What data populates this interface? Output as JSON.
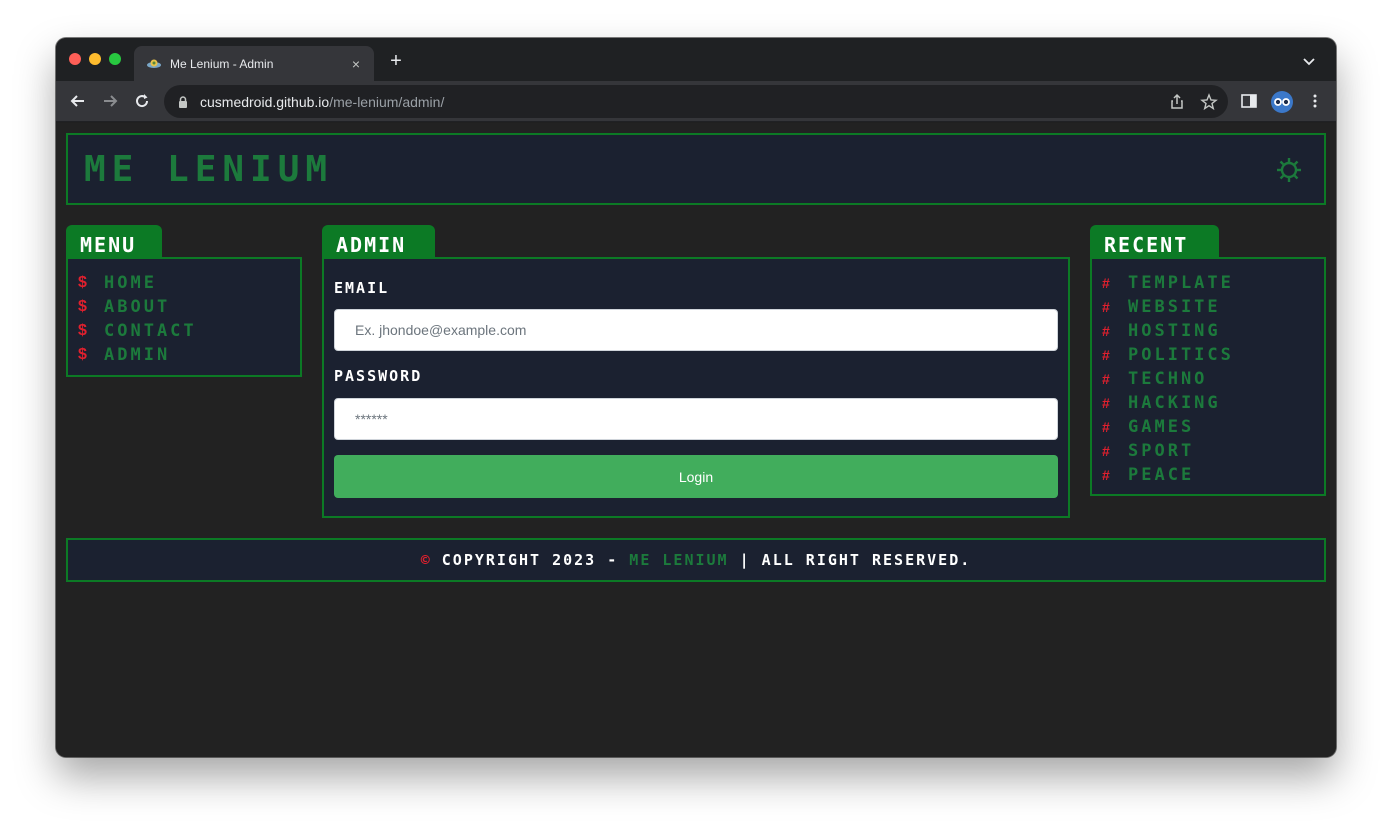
{
  "browser": {
    "tab_title": "Me Lenium - Admin",
    "tab_close": "×",
    "new_tab": "+",
    "url_host": "cusmedroid.github.io",
    "url_path": "/me-lenium/admin/"
  },
  "site": {
    "title": "Me Lenium"
  },
  "menu": {
    "label": "Menu",
    "bullet": "$",
    "items": [
      {
        "label": "Home"
      },
      {
        "label": "About"
      },
      {
        "label": "Contact"
      },
      {
        "label": "Admin"
      }
    ]
  },
  "admin": {
    "label": "Admin",
    "email_label": "Email",
    "email_placeholder": "Ex. jhondoe@example.com",
    "password_label": "Password",
    "password_placeholder": "******",
    "login_label": "Login"
  },
  "recent": {
    "label": "Recent",
    "bullet": "#",
    "items": [
      {
        "label": "Template"
      },
      {
        "label": "Website"
      },
      {
        "label": "Hosting"
      },
      {
        "label": "Politics"
      },
      {
        "label": "Techno"
      },
      {
        "label": "Hacking"
      },
      {
        "label": "Games"
      },
      {
        "label": "Sport"
      },
      {
        "label": "Peace"
      }
    ]
  },
  "footer": {
    "copy_symbol": "©",
    "prefix": "Copyright 2023 - ",
    "brand": "Me Lenium",
    "suffix": " | All Right Reserved."
  },
  "colors": {
    "accent": "#0c7a25",
    "link": "#1c7a3c",
    "panel_bg": "#1b2130",
    "page_bg": "#222222",
    "bullet": "#e0202e",
    "login_button": "#41ad5c"
  }
}
